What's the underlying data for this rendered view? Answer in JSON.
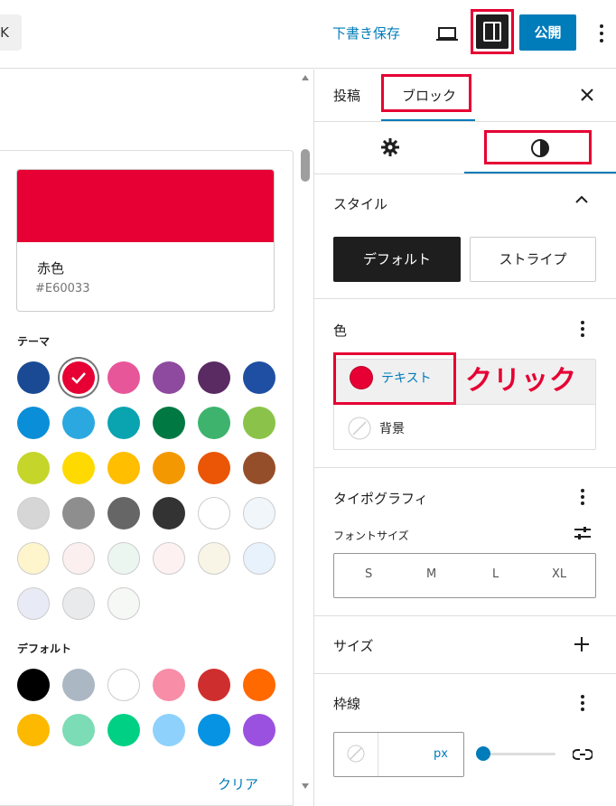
{
  "toolbar": {
    "back_label": "K",
    "save_draft": "下書き保存",
    "publish": "公開"
  },
  "picker": {
    "selected": {
      "name": "赤色",
      "hex": "#E60033",
      "color": "#E60033"
    },
    "theme_label": "テーマ",
    "default_label": "デフォルト",
    "clear": "クリア",
    "theme_colors": [
      "#1A4A94",
      "#E60033",
      "#E8569A",
      "#8E4A9E",
      "#5A2A62",
      "#1E4FA3",
      "#0B8ED8",
      "#2BA8E0",
      "#0AA3B0",
      "#007842",
      "#3DB36E",
      "#8BC34A",
      "#C5D52A",
      "#FFDA00",
      "#FFBE00",
      "#F39800",
      "#EA5506",
      "#954E2A",
      "#D6D6D6",
      "#8E8E8E",
      "#666666",
      "#333333",
      "#FFFFFF",
      "#F1F6FB",
      "#FFF5CC",
      "#FBEFF0",
      "#EBF6F1",
      "#FEF1F1",
      "#F8F5E6",
      "#E8F2FC",
      "#E8EAF6",
      "#E8EAEC",
      "#F6F8F5"
    ],
    "default_colors": [
      "#000000",
      "#ABB8C3",
      "#FFFFFF",
      "#F78DA7",
      "#CF2E2E",
      "#FF6900",
      "#FCB900",
      "#7BDCB5",
      "#00D084",
      "#8ED1FC",
      "#0693E3",
      "#9B51E0"
    ]
  },
  "sidebar": {
    "tab_post": "投稿",
    "tab_block": "ブロック",
    "style_panel": {
      "title": "スタイル",
      "btn_default": "デフォルト",
      "btn_stripe": "ストライプ"
    },
    "color_panel": {
      "title": "色",
      "text_item": "テキスト",
      "background_item": "背景",
      "callout": "クリック"
    },
    "typography_panel": {
      "title": "タイポグラフィ",
      "font_size_label": "フォントサイズ",
      "sizes": [
        "S",
        "M",
        "L",
        "XL"
      ]
    },
    "size_panel": {
      "title": "サイズ"
    },
    "border_panel": {
      "title": "枠線",
      "unit": "px"
    }
  },
  "colors": {
    "accent": "#007CBA",
    "highlight": "#E60033"
  }
}
